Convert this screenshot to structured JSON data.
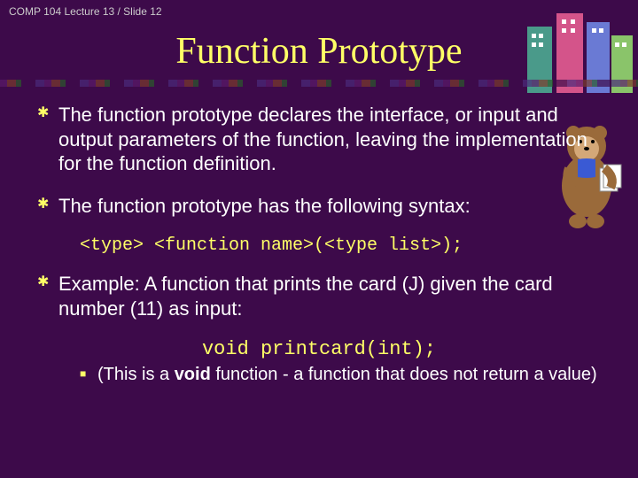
{
  "header": "COMP 104 Lecture 13 / Slide 12",
  "title": "Function Prototype",
  "bullets": {
    "b1": "The function prototype declares the interface, or input and output parameters of the function, leaving the implementation for the function definition.",
    "b2": "The function prototype has the following syntax:",
    "code1": "<type> <function name>(<type list>);",
    "b3": "Example: A function that prints the card (J) given the card number (11) as input:",
    "code2": "void printcard(int);",
    "sub1_pre": "(This is a ",
    "sub1_bold": "void",
    "sub1_post": " function - a function that does not return a value)"
  }
}
